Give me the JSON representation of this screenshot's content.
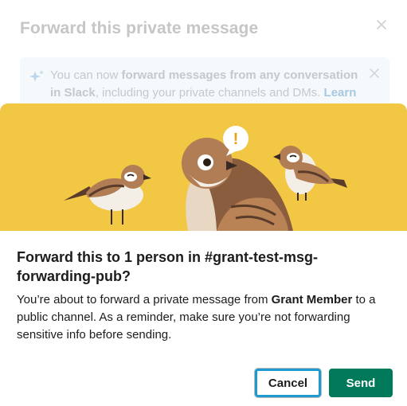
{
  "background_modal": {
    "title": "Forward this private message",
    "banner": {
      "prefix": "You can now ",
      "bold": "forward messages from any conversation in Slack",
      "middle": ", including your private channels and DMs. ",
      "link": "Learn more"
    }
  },
  "dialog": {
    "heading": "Forward this to 1 person in #grant-test-msg-forwarding-pub?",
    "body_prefix": "You’re about to forward a private message from ",
    "body_sender": "Grant Member",
    "body_suffix": " to a public channel. As a reminder, make sure you’re not forwarding sensitive info before sending.",
    "cancel_label": "Cancel",
    "send_label": "Send",
    "alert_glyph": "!"
  },
  "colors": {
    "hero_yellow": "#f2c744",
    "send_green": "#007a5a",
    "focus_blue": "#1d9bd1"
  },
  "icons": [
    "close-icon",
    "sparkle-icon",
    "exclamation-icon"
  ]
}
